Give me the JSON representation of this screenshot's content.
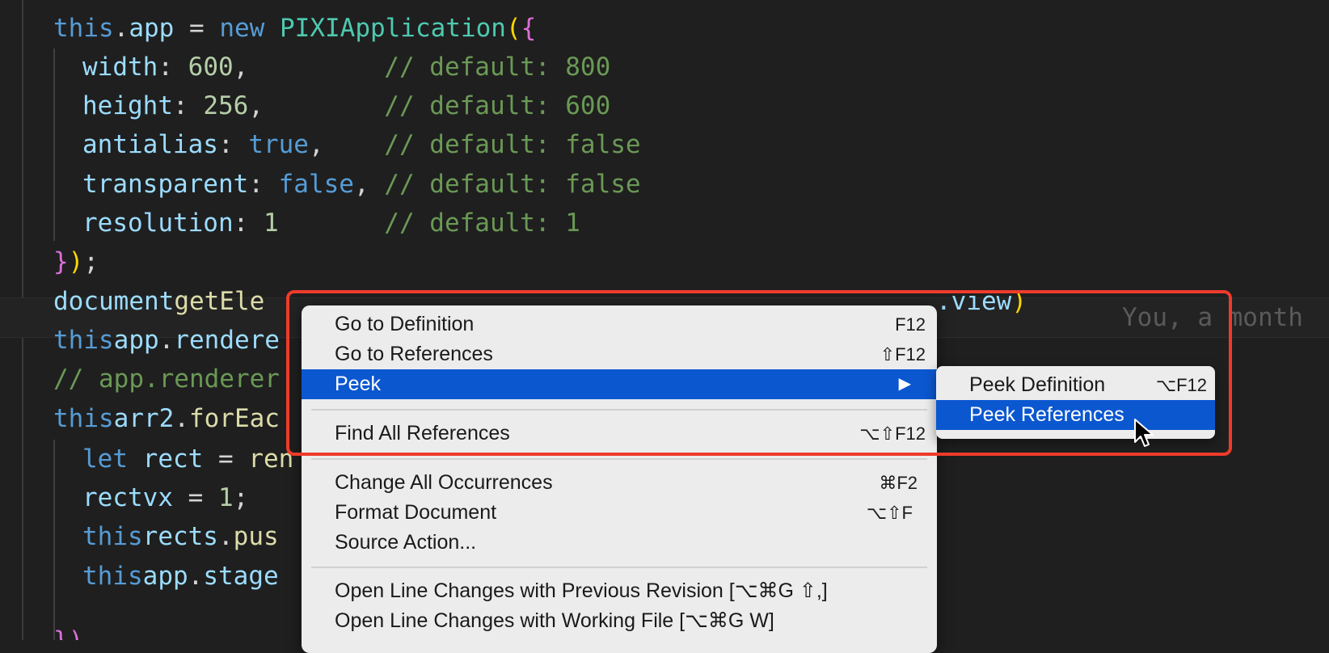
{
  "code": {
    "line1": {
      "a": "this",
      "b": ".",
      "c": "app",
      "d": " = ",
      "e": "new",
      "f": " ",
      "g": "PIXI",
      ".": ".",
      "h": "Application",
      "i": "(",
      "j": "{"
    },
    "line2": {
      "prop": "width",
      "sep": ": ",
      "val": "600",
      "tail": ",         ",
      "com": "// default: 800"
    },
    "line3": {
      "prop": "height",
      "sep": ": ",
      "val": "256",
      "tail": ",        ",
      "com": "// default: 600"
    },
    "line4": {
      "prop": "antialias",
      "sep": ": ",
      "val": "true",
      "tail": ",    ",
      "com": "// default: false"
    },
    "line5": {
      "prop": "transparent",
      "sep": ": ",
      "val": "false",
      "tail": ", ",
      "com": "// default: false"
    },
    "line6": {
      "prop": "resolution",
      "sep": ": ",
      "val": "1",
      "tail": "       ",
      "com": "// default: 1"
    },
    "line7": {
      "a": "}",
      ")": ")",
      "semi": ";"
    },
    "line8": {
      "a": "document",
      ".": ".",
      "fn": "getEle"
    },
    "line8r": {
      "a": ".view",
      "close": ")"
    },
    "line9": {
      "a": "this",
      ".": ".",
      "b": "app",
      ".2": ".",
      "c": "rendere"
    },
    "line10": {
      "com": "// app.renderer"
    },
    "line11": {
      "a": "this",
      ".": ".",
      "b": "arr2",
      ".2": ".",
      "fn": "forEac"
    },
    "line12": {
      "kw": "let",
      "sp": " ",
      "v": "rect",
      " =": " = ",
      "fn": "ren"
    },
    "line13": {
      "a": "rect",
      ".": ".",
      "b": "vx",
      " =": " = ",
      "n": "1",
      ";": ";"
    },
    "line14": {
      "a": "this",
      ".": ".",
      "b": "rects",
      ".2": ".",
      "fn": "pus"
    },
    "line15": {
      "a": "this",
      ".": ".",
      "b": "app",
      ".2": ".",
      "c": "stage"
    },
    "line16": {
      "a": "})"
    },
    "blame": "You, a month"
  },
  "context_menu": {
    "items": [
      {
        "label": "Go to Definition",
        "shortcut": "F12"
      },
      {
        "label": "Go to References",
        "shortcut": "⇧F12"
      },
      {
        "label": "Peek",
        "shortcut": "▶"
      },
      {
        "label": "Find All References",
        "shortcut": "⌥⇧F12"
      },
      {
        "label": "Change All Occurrences",
        "shortcut": "⌘F2"
      },
      {
        "label": "Format Document",
        "shortcut": "⌥⇧F"
      },
      {
        "label": "Source Action...",
        "shortcut": ""
      },
      {
        "label": "Open Line Changes with Previous Revision [⌥⌘G ⇧,]",
        "shortcut": ""
      },
      {
        "label": "Open Line Changes with Working File [⌥⌘G W]",
        "shortcut": ""
      }
    ]
  },
  "peek_submenu": {
    "items": [
      {
        "label": "Peek Definition",
        "shortcut": "⌥F12"
      },
      {
        "label": "Peek References",
        "shortcut": ""
      }
    ]
  },
  "colors": {
    "accent": "#0b57d0",
    "highlight": "#ee3b2b"
  }
}
